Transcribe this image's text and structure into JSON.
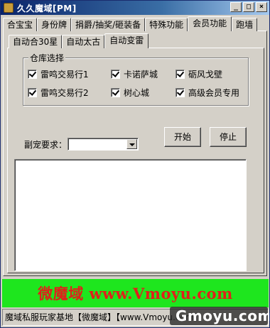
{
  "window": {
    "title": "久久魔域[PM]"
  },
  "title_buttons": {
    "minimize": "_",
    "maximize": "□",
    "close": "×"
  },
  "main_tabs": [
    "合宝宝",
    "身份牌",
    "捐爵/抽奖/砸装备",
    "特殊功能",
    "会员功能",
    "跑墙"
  ],
  "sub_tabs": [
    "自动合30星",
    "自动太古",
    "自动变雷"
  ],
  "warehouse": {
    "title": "仓库选择",
    "options": [
      {
        "label": "雷鸣交易行1",
        "checked": true
      },
      {
        "label": "卡诺萨城",
        "checked": true
      },
      {
        "label": "砺风戈壁",
        "checked": true
      },
      {
        "label": "雷鸣交易行2",
        "checked": true
      },
      {
        "label": "树心城",
        "checked": true
      },
      {
        "label": "高级会员专用",
        "checked": true
      }
    ]
  },
  "pet_requirement": {
    "label": "副宠要求：",
    "value": ""
  },
  "buttons": {
    "start": "开始",
    "stop": "停止"
  },
  "banner": {
    "text": "微魔域 www.Vmoyu.com",
    "background": "#1ee61e",
    "color": "#e0201a"
  },
  "status": {
    "text": "魔域私服玩家基地【微魔域】【www.Vmoyu.com】"
  },
  "watermark": {
    "text": "Gmoyu.com"
  }
}
